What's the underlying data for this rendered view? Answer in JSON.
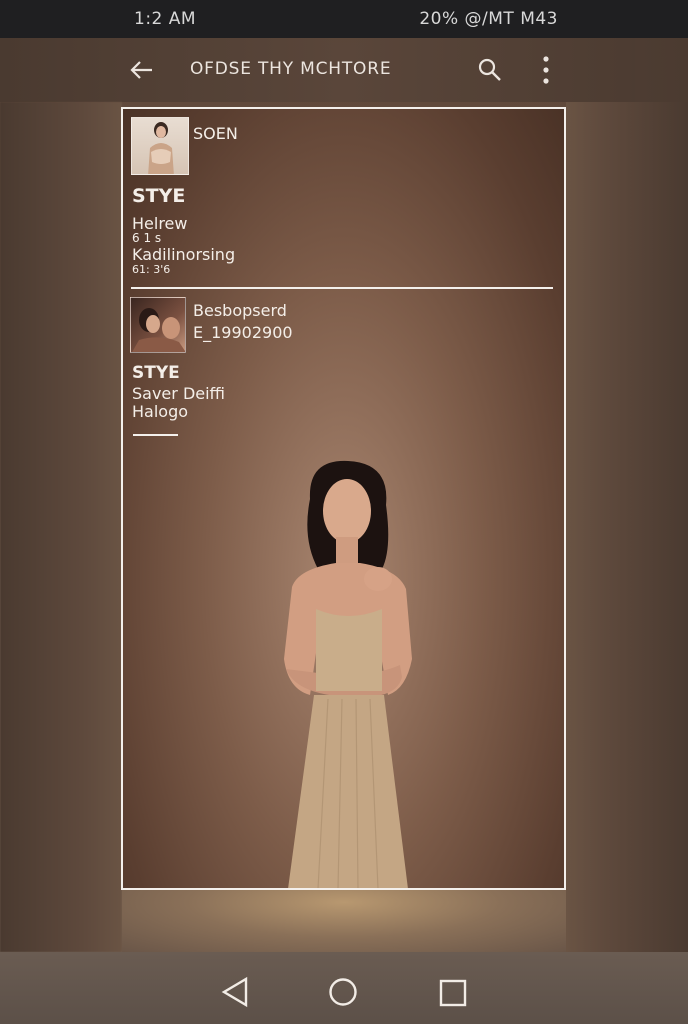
{
  "status_bar": {
    "time": "1:2 AM",
    "indicators": "20% @/MT M43"
  },
  "app_bar": {
    "title": "OFDSE THY MCHTORE",
    "back_icon": "arrow-left-icon",
    "search_icon": "search-icon",
    "more_icon": "more-vert-icon"
  },
  "card": {
    "entry1": {
      "name": "SOEN",
      "heading": "STYE",
      "line1": "Helrew",
      "line2": "6 1 s",
      "line3": "Kadilinorsing",
      "line4": "61: 3'6"
    },
    "entry2": {
      "name": "Besbopserd",
      "number": "E_19902900",
      "heading": "STYE",
      "line1": "Saver Deiffi",
      "line2": "Halogo"
    }
  },
  "nav_bar": {
    "back": "nav-back-icon",
    "home": "nav-home-icon",
    "recents": "nav-recents-icon"
  },
  "colors": {
    "status_bar": "#1f1f21",
    "frame_border": "#f4f0ec",
    "background": "#6a5242"
  }
}
